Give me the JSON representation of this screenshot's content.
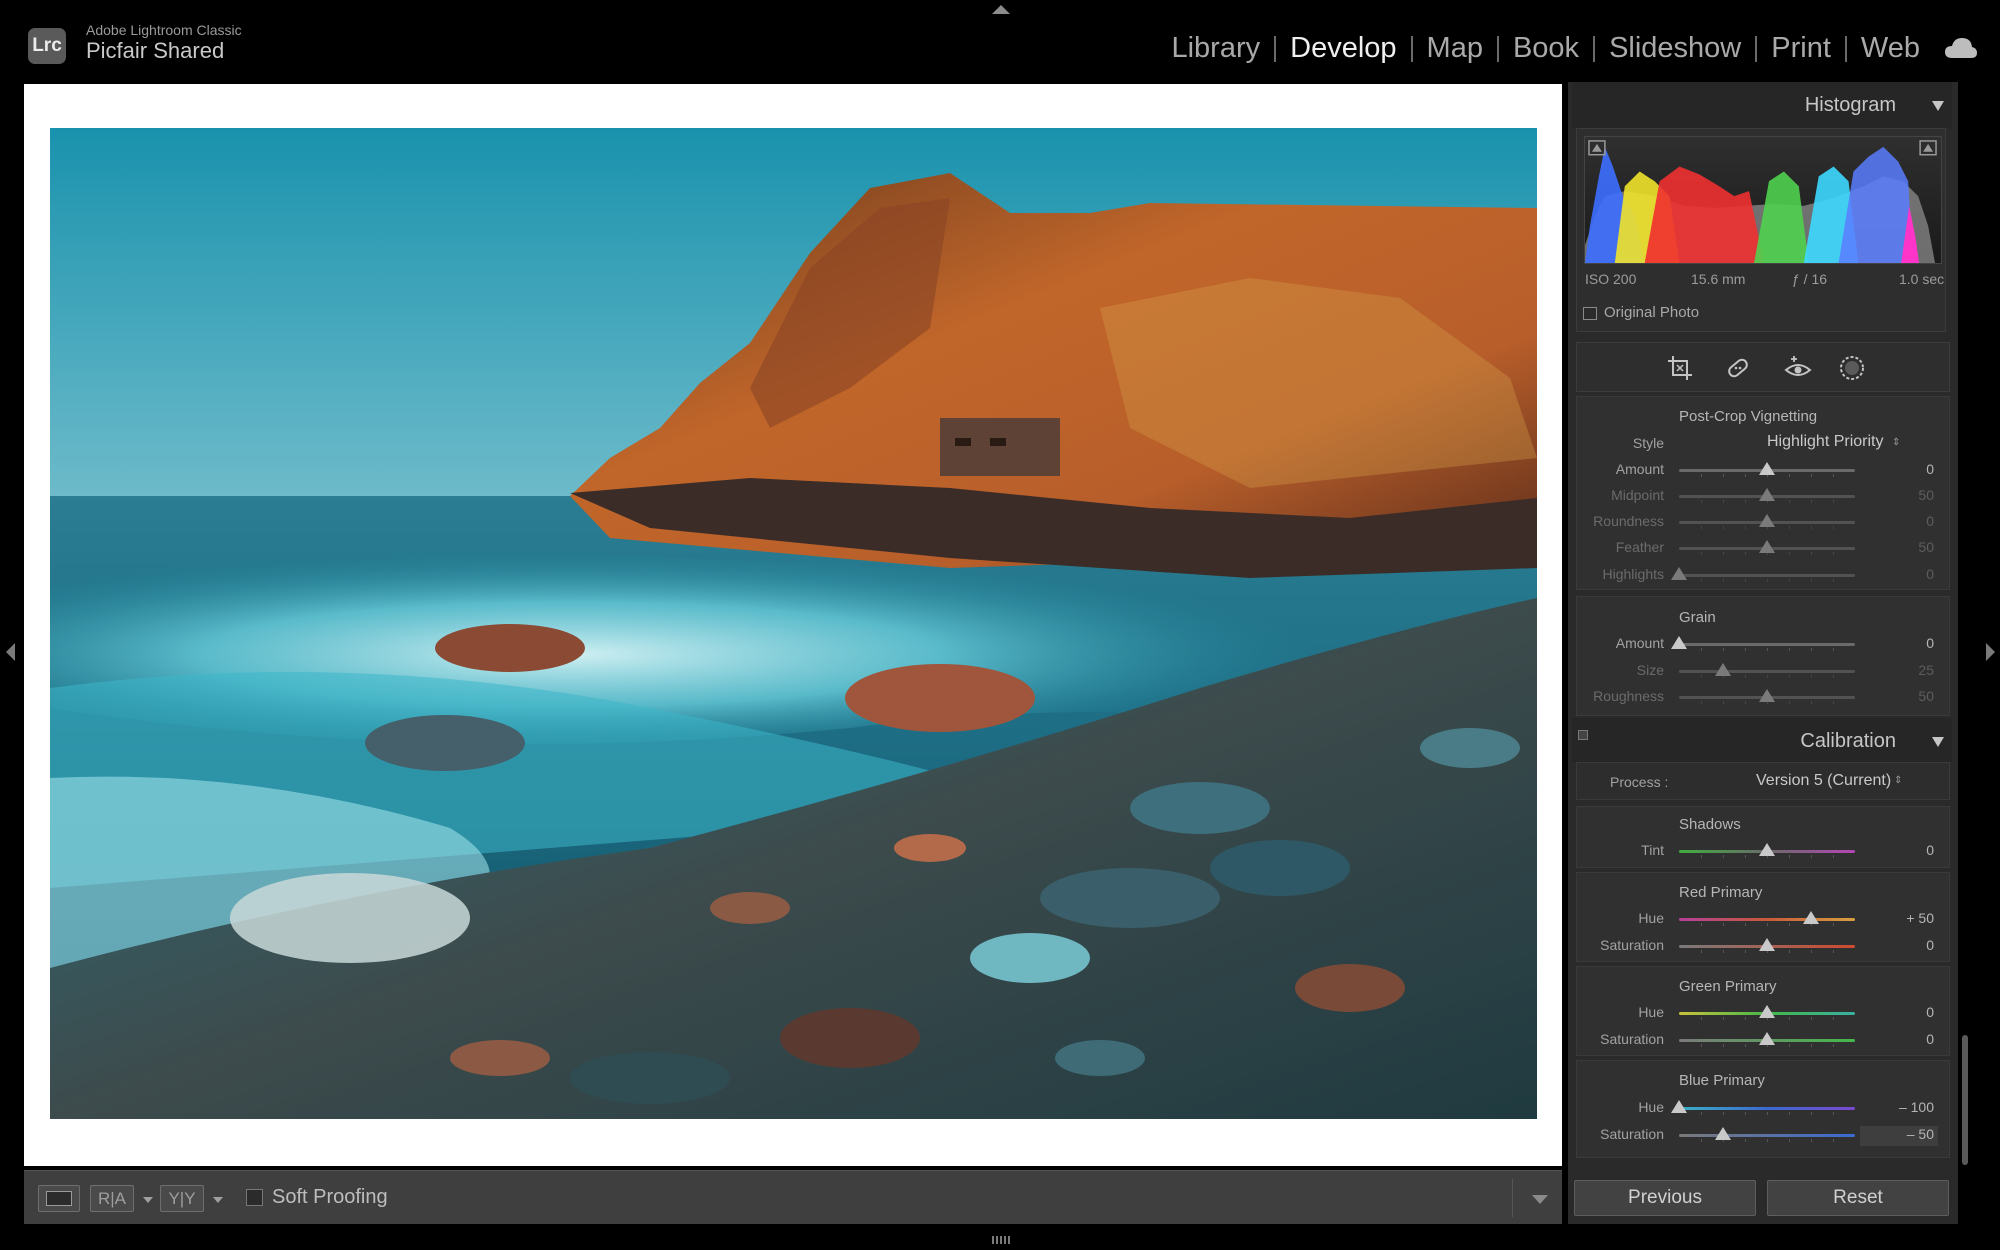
{
  "app": {
    "logo": "Lrc",
    "name": "Adobe Lightroom Classic",
    "catalog": "Picfair Shared"
  },
  "modules": [
    {
      "label": "Library",
      "active": false
    },
    {
      "label": "Develop",
      "active": true
    },
    {
      "label": "Map",
      "active": false
    },
    {
      "label": "Book",
      "active": false
    },
    {
      "label": "Slideshow",
      "active": false
    },
    {
      "label": "Print",
      "active": false
    },
    {
      "label": "Web",
      "active": false
    }
  ],
  "histogram": {
    "title": "Histogram",
    "iso": "ISO 200",
    "focal": "15.6 mm",
    "aperture": "ƒ / 16",
    "shutter": "1.0 sec",
    "original_photo": "Original Photo"
  },
  "tools": [
    "crop-overlay-icon",
    "spot-removal-icon",
    "red-eye-icon",
    "radial-filter-icon"
  ],
  "vignetting": {
    "title": "Post-Crop Vignetting",
    "style_label": "Style",
    "style_value": "Highlight Priority",
    "sliders": [
      {
        "label": "Amount",
        "value": "0",
        "position": 0.5,
        "dim": false
      },
      {
        "label": "Midpoint",
        "value": "50",
        "position": 0.5,
        "dim": true
      },
      {
        "label": "Roundness",
        "value": "0",
        "position": 0.5,
        "dim": true
      },
      {
        "label": "Feather",
        "value": "50",
        "position": 0.5,
        "dim": true
      },
      {
        "label": "Highlights",
        "value": "0",
        "position": 0.0,
        "dim": true
      }
    ]
  },
  "grain": {
    "title": "Grain",
    "sliders": [
      {
        "label": "Amount",
        "value": "0",
        "position": 0.0,
        "dim": false
      },
      {
        "label": "Size",
        "value": "25",
        "position": 0.25,
        "dim": true
      },
      {
        "label": "Roughness",
        "value": "50",
        "position": 0.5,
        "dim": true
      }
    ]
  },
  "calibration": {
    "title": "Calibration",
    "process_label": "Process :",
    "process_value": "Version 5 (Current)",
    "shadows": {
      "title": "Shadows",
      "tint": {
        "label": "Tint",
        "value": "0",
        "position": 0.5
      }
    },
    "red": {
      "title": "Red Primary",
      "hue": {
        "label": "Hue",
        "value": "+ 50",
        "position": 0.75
      },
      "sat": {
        "label": "Saturation",
        "value": "0",
        "position": 0.5
      }
    },
    "green": {
      "title": "Green Primary",
      "hue": {
        "label": "Hue",
        "value": "0",
        "position": 0.5
      },
      "sat": {
        "label": "Saturation",
        "value": "0",
        "position": 0.5
      }
    },
    "blue": {
      "title": "Blue Primary",
      "hue": {
        "label": "Hue",
        "value": "– 100",
        "position": 0.0
      },
      "sat": {
        "label": "Saturation",
        "value": "– 50",
        "position": 0.25
      }
    }
  },
  "toolbar": {
    "soft_proofing": "Soft Proofing",
    "ra": "R|A",
    "yy": "Y|Y"
  },
  "buttons": {
    "previous": "Previous",
    "reset": "Reset"
  },
  "colors": {
    "accent_active": "#f0f0f0",
    "panel": "#2a2a2a",
    "background": "#000000"
  }
}
